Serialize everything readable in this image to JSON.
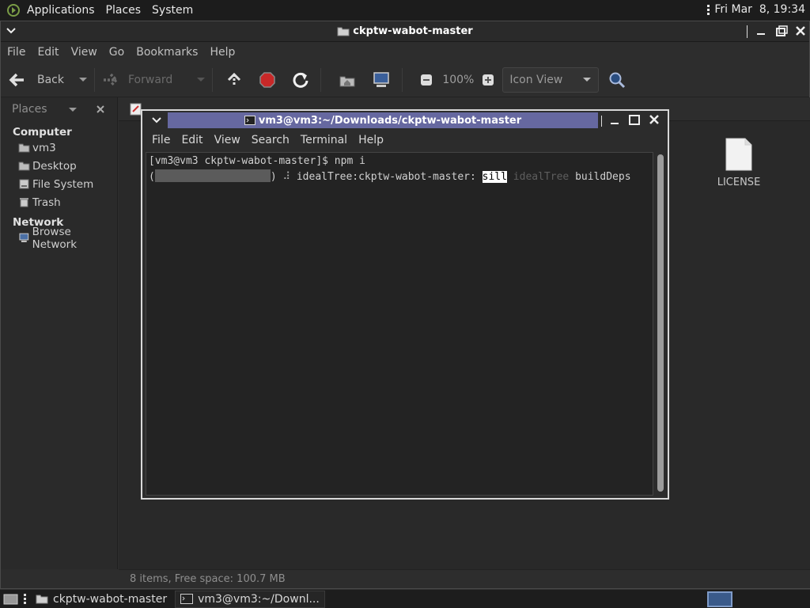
{
  "top_panel": {
    "menus": [
      "Applications",
      "Places",
      "System"
    ],
    "clock": "Fri Mar  8, 19:34"
  },
  "file_manager": {
    "title": "ckptw-wabot-master",
    "menus": [
      "File",
      "Edit",
      "View",
      "Go",
      "Bookmarks",
      "Help"
    ],
    "toolbar": {
      "back": "Back",
      "forward": "Forward",
      "zoom": "100%",
      "view_mode": "Icon View"
    },
    "sidebar": {
      "header": "Places",
      "sections": [
        {
          "title": "Computer",
          "items": [
            "vm3",
            "Desktop",
            "File System",
            "Trash"
          ]
        },
        {
          "title": "Network",
          "items": [
            "Browse Network"
          ]
        }
      ]
    },
    "files": [
      {
        "name": "LICENSE"
      }
    ],
    "status": "8 items, Free space: 100.7 MB"
  },
  "terminal": {
    "title": "vm3@vm3:~/Downloads/ckptw-wabot-master",
    "menus": [
      "File",
      "Edit",
      "View",
      "Search",
      "Terminal",
      "Help"
    ],
    "line1": "[vm3@vm3 ckptw-wabot-master]$ npm i",
    "line2_open": "(",
    "line2_close": ") ",
    "line2_spinner": "⠼",
    "line2_text": " idealTree:ckptw-wabot-master: ",
    "line2_sill": "sill",
    "line2_dim": " idealTree",
    "line2_end": " buildDeps"
  },
  "taskbar": {
    "tasks": [
      "ckptw-wabot-master",
      "vm3@vm3:~/Downl..."
    ]
  }
}
